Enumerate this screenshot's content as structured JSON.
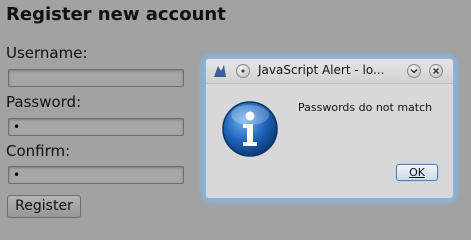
{
  "form": {
    "title": "Register new account",
    "username_label": "Username:",
    "username_value": "",
    "password_label": "Password:",
    "password_value": "•",
    "confirm_label": "Confirm:",
    "confirm_value": "•",
    "register_label": "Register"
  },
  "dialog": {
    "title": "JavaScript Alert - lo...",
    "message": "Passwords do not match",
    "ok_label": "OK",
    "icon": "info-icon"
  },
  "colors": {
    "background": "#a2a2a2",
    "dialog_glow": "#78beff",
    "info_blue": "#1f63b8"
  }
}
